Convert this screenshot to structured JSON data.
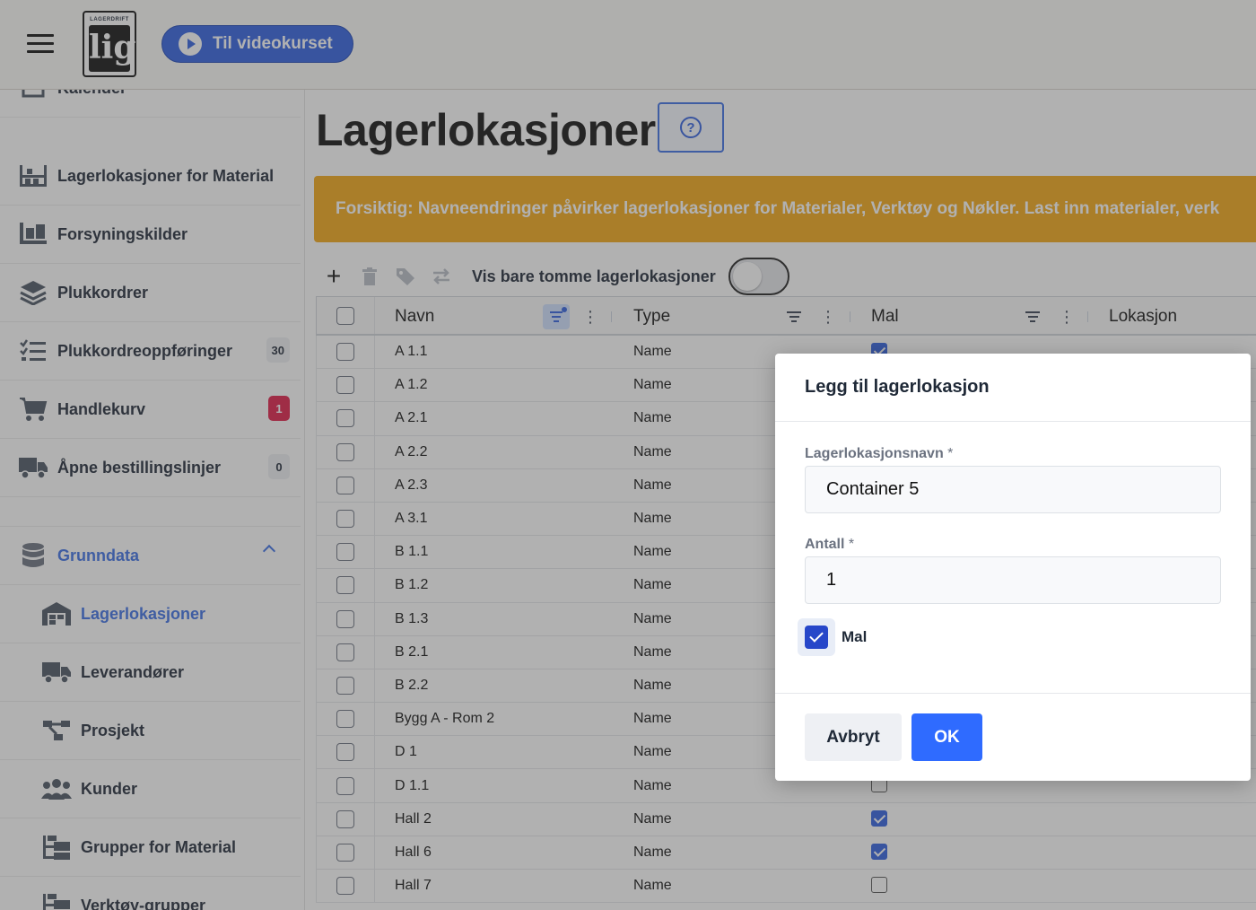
{
  "header": {
    "logo_text": "LAGERDRIFT",
    "logo_mark": "lig",
    "video_button": "Til videokurset"
  },
  "sidebar": {
    "items": [
      {
        "label": "Kalender",
        "icon": "calendar-icon"
      },
      {
        "label": "Lagerlokasjoner for Material",
        "icon": "warehouse-shelf-icon"
      },
      {
        "label": "Forsyningskilder",
        "icon": "pallet-icon"
      },
      {
        "label": "Plukkordrer",
        "icon": "layers-icon"
      },
      {
        "label": "Plukkordreoppføringer",
        "icon": "checklist-icon",
        "badge": "30"
      },
      {
        "label": "Handlekurv",
        "icon": "cart-icon",
        "badge": "1"
      },
      {
        "label": "Åpne bestillingslinjer",
        "icon": "truck-icon",
        "badge": "0"
      }
    ],
    "section": {
      "label": "Grunndata",
      "icon": "database-icon",
      "expanded": true
    },
    "sub_items": [
      {
        "label": "Lagerlokasjoner",
        "icon": "warehouse-icon",
        "active": true
      },
      {
        "label": "Leverandører",
        "icon": "delivery-truck-icon"
      },
      {
        "label": "Prosjekt",
        "icon": "project-tree-icon"
      },
      {
        "label": "Kunder",
        "icon": "users-icon"
      },
      {
        "label": "Grupper for Material",
        "icon": "group-tree-icon"
      },
      {
        "label": "Verktøy-grupper",
        "icon": "tool-group-icon"
      }
    ]
  },
  "page": {
    "title": "Lagerlokasjoner",
    "help_icon": "?",
    "warning": "Forsiktig: Navneendringer påvirker lagerlokasjoner for Materialer, Verktøy og Nøkler. Last inn materialer, verk"
  },
  "toolbar": {
    "add_icon": "+",
    "show_empty_label": "Vis bare tomme lagerlokasjoner",
    "show_empty_on": false
  },
  "table": {
    "columns": [
      "Navn",
      "Type",
      "Mal",
      "Lokasjon"
    ],
    "rows": [
      {
        "navn": "A 1.1",
        "type": "Name",
        "mal": true
      },
      {
        "navn": "A 1.2",
        "type": "Name",
        "mal": null
      },
      {
        "navn": "A 2.1",
        "type": "Name",
        "mal": null
      },
      {
        "navn": "A 2.2",
        "type": "Name",
        "mal": null
      },
      {
        "navn": "A 2.3",
        "type": "Name",
        "mal": null
      },
      {
        "navn": "A 3.1",
        "type": "Name",
        "mal": null
      },
      {
        "navn": "B 1.1",
        "type": "Name",
        "mal": null
      },
      {
        "navn": "B 1.2",
        "type": "Name",
        "mal": null
      },
      {
        "navn": "B 1.3",
        "type": "Name",
        "mal": null
      },
      {
        "navn": "B 2.1",
        "type": "Name",
        "mal": null
      },
      {
        "navn": "B 2.2",
        "type": "Name",
        "mal": null
      },
      {
        "navn": "Bygg A - Rom 2",
        "type": "Name",
        "mal": null
      },
      {
        "navn": "D 1",
        "type": "Name",
        "mal": null
      },
      {
        "navn": "D 1.1",
        "type": "Name",
        "mal": false
      },
      {
        "navn": "Hall 2",
        "type": "Name",
        "mal": true
      },
      {
        "navn": "Hall 6",
        "type": "Name",
        "mal": true
      },
      {
        "navn": "Hall 7",
        "type": "Name",
        "mal": false
      }
    ]
  },
  "modal": {
    "title": "Legg til lagerlokasjon",
    "name_label": "Lagerlokasjonsnavn",
    "name_value": "Container 5",
    "qty_label": "Antall",
    "qty_value": "1",
    "required_mark": "*",
    "mal_label": "Mal",
    "mal_checked": true,
    "cancel_label": "Avbryt",
    "ok_label": "OK"
  },
  "colors": {
    "accent": "#2f5fe0",
    "warning": "#f3a716",
    "badge_red": "#e11d48"
  }
}
